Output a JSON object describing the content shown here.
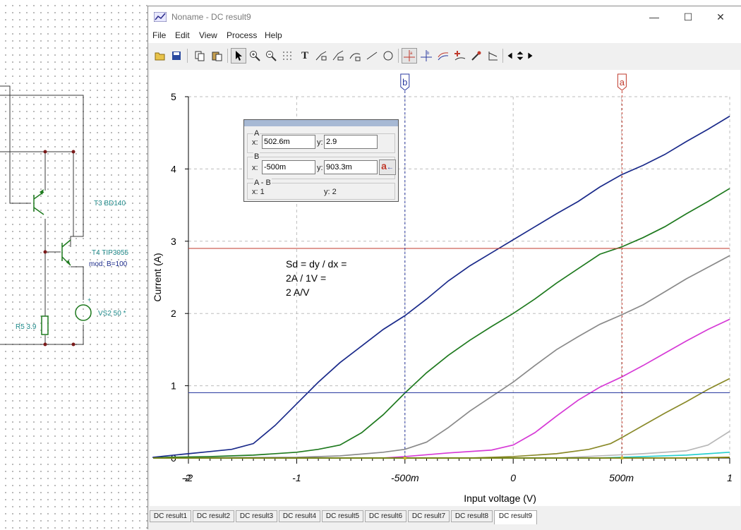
{
  "schematic": {
    "labels": {
      "t3": "T3 BD140",
      "t4": "T4 TIP3055",
      "t4_mod": "mod: B=100",
      "r5": "R5 3.9",
      "vs2": "VS2 50 *",
      "vs2_plus": "+"
    }
  },
  "window": {
    "title": "Noname - DC result9",
    "controls": {
      "minimize": "—",
      "maximize": "☐",
      "close": "✕"
    },
    "menu": [
      "File",
      "Edit",
      "View",
      "Process",
      "Help"
    ]
  },
  "toolbar": {
    "icons": [
      "open-icon",
      "save-icon",
      "copy-icon",
      "paste-icon",
      "pointer-icon",
      "zoom-in-icon",
      "zoom-out-icon",
      "grid-icon",
      "text-icon",
      "label-icon",
      "label-alt-icon",
      "curve-label-icon",
      "line-icon",
      "circle-icon",
      "cursor-a-icon",
      "cursor-b-icon",
      "curve-cursor-icon",
      "add-marker-icon",
      "pick-icon",
      "slope-icon",
      "left-arrow-icon",
      "up-down-icon",
      "right-arrow-icon"
    ],
    "text_tool_glyph": "T",
    "cursor_a_glyph": "a",
    "cursor_b_glyph": "b"
  },
  "chart_data": {
    "type": "line",
    "xlabel": "Input voltage (V)",
    "ylabel": "Current (A)",
    "xlim": [
      -1.5,
      1
    ],
    "ylim": [
      0,
      5
    ],
    "x_ticks": [
      {
        "v": -1.5,
        "label": "-2"
      },
      {
        "v": -1.0,
        "label": "-1"
      },
      {
        "v": -0.5,
        "label": "-500m"
      },
      {
        "v": 0.0,
        "label": "0"
      },
      {
        "v": 0.5,
        "label": "500m"
      },
      {
        "v": 1.0,
        "label": "1"
      }
    ],
    "x_edge_label": "-2",
    "y_ticks": [
      0,
      1,
      2,
      3,
      4,
      5
    ],
    "grid": true,
    "series": [
      {
        "color": "#1a2a8a",
        "points": [
          [
            -2,
            0
          ],
          [
            -1.8,
            0.01
          ],
          [
            -1.6,
            0.03
          ],
          [
            -1.5,
            0.06
          ],
          [
            -1.4,
            0.09
          ],
          [
            -1.3,
            0.12
          ],
          [
            -1.2,
            0.2
          ],
          [
            -1.1,
            0.45
          ],
          [
            -1.0,
            0.75
          ],
          [
            -0.9,
            1.05
          ],
          [
            -0.8,
            1.32
          ],
          [
            -0.7,
            1.55
          ],
          [
            -0.6,
            1.78
          ],
          [
            -0.5,
            1.97
          ],
          [
            -0.4,
            2.2
          ],
          [
            -0.3,
            2.45
          ],
          [
            -0.2,
            2.66
          ],
          [
            -0.1,
            2.84
          ],
          [
            0.0,
            3.02
          ],
          [
            0.1,
            3.2
          ],
          [
            0.2,
            3.38
          ],
          [
            0.3,
            3.55
          ],
          [
            0.4,
            3.75
          ],
          [
            0.5,
            3.92
          ],
          [
            0.6,
            4.05
          ],
          [
            0.7,
            4.2
          ],
          [
            0.8,
            4.38
          ],
          [
            0.9,
            4.55
          ],
          [
            1.0,
            4.73
          ]
        ]
      },
      {
        "color": "#1f7a1f",
        "points": [
          [
            -2,
            0
          ],
          [
            -1.6,
            0.01
          ],
          [
            -1.4,
            0.02
          ],
          [
            -1.2,
            0.04
          ],
          [
            -1.0,
            0.08
          ],
          [
            -0.9,
            0.12
          ],
          [
            -0.8,
            0.18
          ],
          [
            -0.7,
            0.35
          ],
          [
            -0.6,
            0.6
          ],
          [
            -0.5,
            0.9
          ],
          [
            -0.4,
            1.18
          ],
          [
            -0.3,
            1.42
          ],
          [
            -0.2,
            1.63
          ],
          [
            -0.1,
            1.82
          ],
          [
            0.0,
            2.0
          ],
          [
            0.1,
            2.2
          ],
          [
            0.2,
            2.42
          ],
          [
            0.3,
            2.62
          ],
          [
            0.4,
            2.82
          ],
          [
            0.5,
            2.92
          ],
          [
            0.6,
            3.05
          ],
          [
            0.7,
            3.2
          ],
          [
            0.8,
            3.38
          ],
          [
            0.9,
            3.55
          ],
          [
            1.0,
            3.73
          ]
        ]
      },
      {
        "color": "#8a8a8a",
        "points": [
          [
            -2,
            0
          ],
          [
            -1.0,
            0.01
          ],
          [
            -0.8,
            0.03
          ],
          [
            -0.6,
            0.08
          ],
          [
            -0.5,
            0.12
          ],
          [
            -0.4,
            0.22
          ],
          [
            -0.3,
            0.42
          ],
          [
            -0.2,
            0.65
          ],
          [
            -0.1,
            0.85
          ],
          [
            0.0,
            1.05
          ],
          [
            0.1,
            1.28
          ],
          [
            0.2,
            1.5
          ],
          [
            0.3,
            1.68
          ],
          [
            0.4,
            1.85
          ],
          [
            0.5,
            1.98
          ],
          [
            0.6,
            2.12
          ],
          [
            0.7,
            2.3
          ],
          [
            0.8,
            2.48
          ],
          [
            0.9,
            2.64
          ],
          [
            1.0,
            2.8
          ]
        ]
      },
      {
        "color": "#d63ad6",
        "points": [
          [
            -2,
            0
          ],
          [
            -0.6,
            0.0
          ],
          [
            -0.5,
            0.02
          ],
          [
            -0.3,
            0.07
          ],
          [
            -0.1,
            0.11
          ],
          [
            0.0,
            0.18
          ],
          [
            0.1,
            0.35
          ],
          [
            0.2,
            0.58
          ],
          [
            0.3,
            0.8
          ],
          [
            0.4,
            0.98
          ],
          [
            0.5,
            1.12
          ],
          [
            0.6,
            1.28
          ],
          [
            0.7,
            1.45
          ],
          [
            0.8,
            1.62
          ],
          [
            0.9,
            1.78
          ],
          [
            1.0,
            1.92
          ]
        ]
      },
      {
        "color": "#8a8a2a",
        "points": [
          [
            -2,
            0
          ],
          [
            -0.2,
            0.0
          ],
          [
            0.0,
            0.02
          ],
          [
            0.2,
            0.06
          ],
          [
            0.35,
            0.12
          ],
          [
            0.45,
            0.2
          ],
          [
            0.5,
            0.28
          ],
          [
            0.6,
            0.45
          ],
          [
            0.7,
            0.62
          ],
          [
            0.8,
            0.78
          ],
          [
            0.9,
            0.95
          ],
          [
            1.0,
            1.1
          ]
        ]
      },
      {
        "color": "#b8b8b8",
        "points": [
          [
            -2,
            0
          ],
          [
            0.2,
            0.0
          ],
          [
            0.4,
            0.03
          ],
          [
            0.6,
            0.06
          ],
          [
            0.8,
            0.1
          ],
          [
            0.9,
            0.18
          ],
          [
            1.0,
            0.37
          ]
        ]
      },
      {
        "color": "#2ad0d0",
        "points": [
          [
            -2,
            0
          ],
          [
            0.4,
            0.0
          ],
          [
            0.6,
            0.02
          ],
          [
            0.8,
            0.04
          ],
          [
            0.9,
            0.06
          ],
          [
            1.0,
            0.08
          ]
        ]
      },
      {
        "color": "#7a7a00",
        "points": [
          [
            -2,
            0
          ],
          [
            0.8,
            0.0
          ],
          [
            1.0,
            0.01
          ]
        ]
      }
    ],
    "cursor_a": {
      "label": "a",
      "x": 0.5026,
      "y": 2.9,
      "color": "#c0392b"
    },
    "cursor_b": {
      "label": "b",
      "x": -0.5,
      "y": 0.9033,
      "color": "#2a3aa0"
    },
    "annotation": [
      "Sd = dy / dx =",
      "2A / 1V =",
      "2 A/V"
    ]
  },
  "cursor_panel": {
    "group_a": "A",
    "group_b": "B",
    "group_ab": "A - B",
    "x_label": "x:",
    "y_label": "y:",
    "a_x": "502.6m",
    "a_y": "2.9",
    "b_x": "-500m",
    "b_y": "903.3m",
    "swap_glyph": "a",
    "swap_arrow": "←",
    "ab_x": "x:  1",
    "ab_y": "y: 2"
  },
  "tabs": [
    "DC result1",
    "DC result2",
    "DC result3",
    "DC result4",
    "DC result5",
    "DC result6",
    "DC result7",
    "DC result8",
    "DC result9"
  ],
  "active_tab": "DC result9"
}
